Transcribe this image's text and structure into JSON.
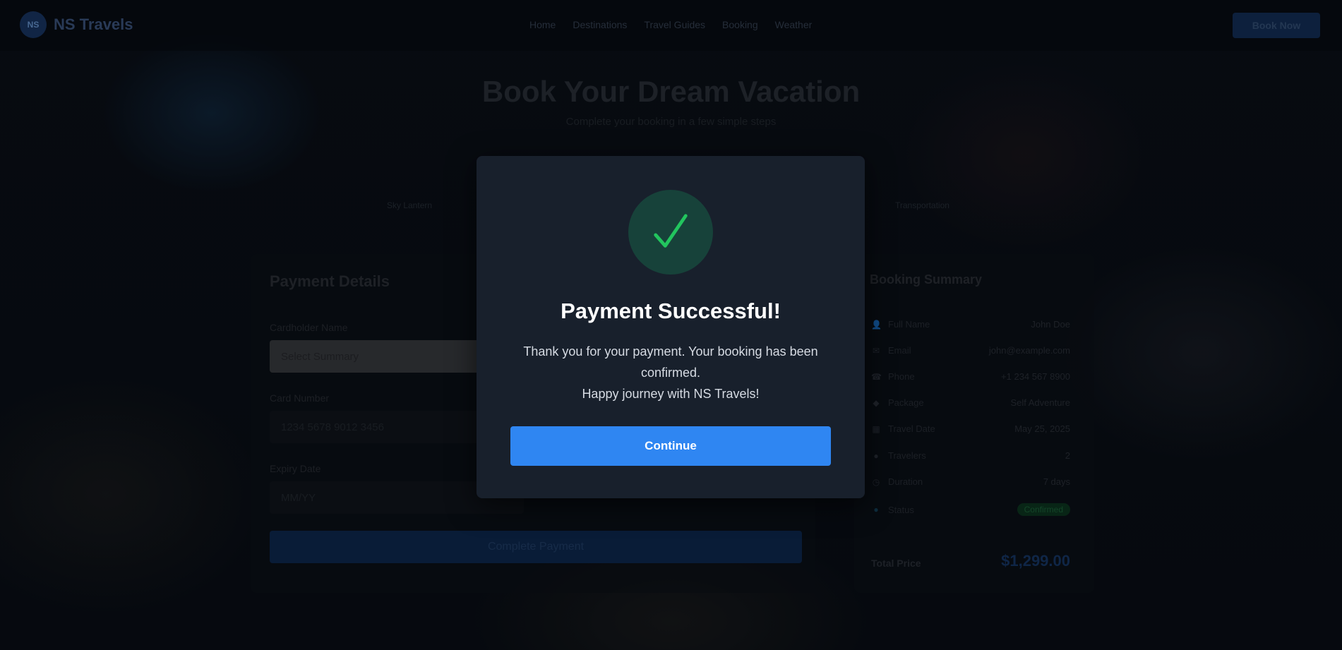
{
  "navbar": {
    "logo_badge": "NS",
    "brand": "NS Travels",
    "links": [
      "Home",
      "Destinations",
      "Travel Guides",
      "Booking",
      "Weather"
    ],
    "cta_label": "Book Now"
  },
  "hero": {
    "title": "Book Your Dream Vacation",
    "subtitle": "Complete your booking in a few simple steps",
    "captions": [
      "Sky Lantern",
      "Transportation"
    ]
  },
  "payment": {
    "heading": "Payment Details",
    "fields": [
      {
        "label": "Cardholder Name",
        "value": "Select Summary"
      },
      {
        "label": "Card Number",
        "value": "1234 5678 9012 3456"
      },
      {
        "label": "Expiry Date",
        "value": "MM/YY"
      }
    ],
    "submit_label": "Complete Payment"
  },
  "summary": {
    "heading": "Booking Summary",
    "rows": [
      {
        "icon": "user-icon",
        "glyph": "👤",
        "label": "Full Name",
        "value": "John Doe"
      },
      {
        "icon": "email-icon",
        "glyph": "✉",
        "label": "Email",
        "value": "john@example.com"
      },
      {
        "icon": "phone-icon",
        "glyph": "☎",
        "label": "Phone",
        "value": "+1 234 567 8900"
      },
      {
        "icon": "package-icon",
        "glyph": "◆",
        "label": "Package",
        "value": "Self Adventure"
      },
      {
        "icon": "calendar-icon",
        "glyph": "▦",
        "label": "Travel Date",
        "value": "May 25, 2025"
      },
      {
        "icon": "travelers-icon",
        "glyph": "●",
        "label": "Travelers",
        "value": "2"
      },
      {
        "icon": "clock-icon",
        "glyph": "◷",
        "label": "Duration",
        "value": "7 days"
      },
      {
        "icon": "status-icon",
        "glyph": "●",
        "label": "Status",
        "value": "Confirmed"
      }
    ],
    "total_label": "Total Price",
    "total_value": "$1,299.00"
  },
  "modal": {
    "icon": "checkmark-icon",
    "title": "Payment Successful!",
    "message_line1": "Thank you for your payment. Your booking has been confirmed.",
    "message_line2": "Happy journey with NS Travels!",
    "button_label": "Continue",
    "colors": {
      "success": "#22c55e",
      "success_bg": "#17423a",
      "button": "#2f86f2",
      "card": "#18202c"
    }
  }
}
